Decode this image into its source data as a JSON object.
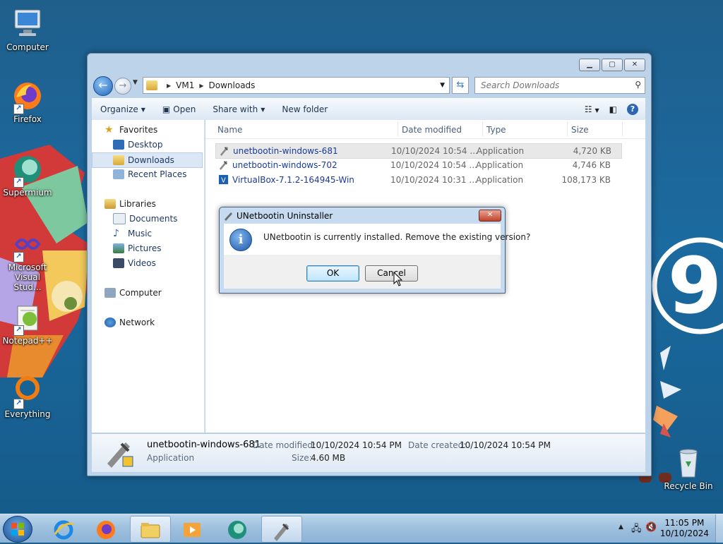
{
  "desktop": {
    "icons": [
      {
        "label": "Computer"
      },
      {
        "label": "Firefox"
      },
      {
        "label": "Supermium"
      },
      {
        "label": "Microsoft Visual Stud..."
      },
      {
        "label": "Notepad++"
      },
      {
        "label": "Everything"
      },
      {
        "label": "Recycle Bin"
      }
    ],
    "wallpaper_number": "9"
  },
  "window": {
    "breadcrumb": [
      "VM1",
      "Downloads"
    ],
    "search_placeholder": "Search Downloads",
    "toolbar": {
      "organize": "Organize",
      "open": "Open",
      "share_with": "Share with",
      "new_folder": "New folder"
    },
    "nav": {
      "favorites": "Favorites",
      "desktop": "Desktop",
      "downloads": "Downloads",
      "recent_places": "Recent Places",
      "libraries": "Libraries",
      "documents": "Documents",
      "music": "Music",
      "pictures": "Pictures",
      "videos": "Videos",
      "computer": "Computer",
      "network": "Network"
    },
    "columns": {
      "name": "Name",
      "date": "Date modified",
      "type": "Type",
      "size": "Size"
    },
    "files": [
      {
        "name": "unetbootin-windows-681",
        "date": "10/10/2024 10:54 ...",
        "type": "Application",
        "size": "4,720 KB"
      },
      {
        "name": "unetbootin-windows-702",
        "date": "10/10/2024 10:54 ...",
        "type": "Application",
        "size": "4,746 KB"
      },
      {
        "name": "VirtualBox-7.1.2-164945-Win",
        "date": "10/10/2024 10:31 ...",
        "type": "Application",
        "size": "108,173 KB"
      }
    ],
    "details": {
      "name": "unetbootin-windows-681",
      "type": "Application",
      "date_modified_label": "Date modified:",
      "date_modified": "10/10/2024 10:54 PM",
      "size_label": "Size:",
      "size": "4.60 MB",
      "date_created_label": "Date created:",
      "date_created": "10/10/2024 10:54 PM"
    }
  },
  "dialog": {
    "title": "UNetbootin Uninstaller",
    "message": "UNetbootin is currently installed. Remove the existing version?",
    "ok": "OK",
    "cancel": "Cancel"
  },
  "taskbar": {
    "time": "11:05 PM",
    "date": "10/10/2024"
  }
}
